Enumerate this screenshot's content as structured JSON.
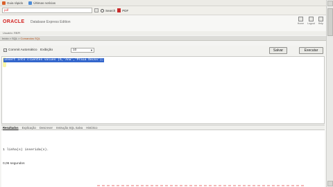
{
  "favorites": {
    "items": [
      {
        "label": "Guia rápido",
        "icon": "site-icon"
      },
      {
        "label": "Últimas notícias",
        "icon": "news-icon"
      }
    ]
  },
  "toolbar": {
    "address_value": "pdf",
    "search_label": "Search",
    "pdf_label": "PDF"
  },
  "header": {
    "logo": "ORACLE",
    "edition": "Database Express Edition",
    "icons": [
      {
        "label": "Home",
        "icon": "home-icon"
      },
      {
        "label": "Logout",
        "icon": "logout-icon"
      },
      {
        "label": "Help",
        "icon": "help-icon"
      }
    ]
  },
  "user": {
    "label": "Usuário: RBPI"
  },
  "breadcrumb": {
    "prefix": "Início > SQL > ",
    "current": "Comandos SQL"
  },
  "command": {
    "autocommit_checked": "✓",
    "autocommit_label": "Commit Automático",
    "display_label": "Exibição",
    "display_value": "10",
    "save_label": "Salvar",
    "run_label": "Executar"
  },
  "editor": {
    "sql": "insert into clientes values (5,'Ana','Praia Decks');"
  },
  "results": {
    "tabs": [
      "Resultados",
      "Explicação",
      "Descrever",
      "Instrução SQL Salva",
      "Histórico"
    ],
    "message": "1 linha(s) inserida(s).",
    "time": "0,06 segundos"
  }
}
